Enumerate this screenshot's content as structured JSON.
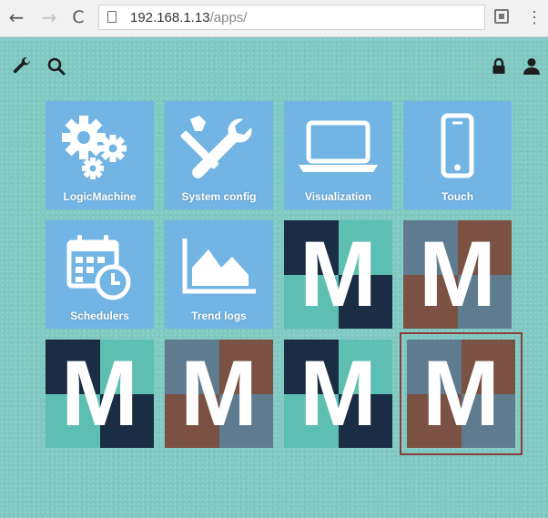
{
  "browser": {
    "url_host": "192.168.1.13",
    "url_path": "/apps/",
    "back_icon": "arrow-left-icon",
    "forward_icon": "arrow-right-icon",
    "reload_icon": "reload-icon",
    "page_icon": "document-icon",
    "extension_icon": "tack-icon",
    "cast_icon": "cast-icon",
    "menu_icon": "kebab-menu-icon"
  },
  "toolbar": {
    "left_icons": [
      "wrench-icon",
      "search-icon"
    ],
    "right_icons": [
      "lock-icon",
      "user-icon"
    ]
  },
  "colors": {
    "background": "#7fc9c2",
    "tile_blue": "#72b5e4",
    "m_navy": "#1b2c45",
    "m_teal": "#5dbfb2",
    "m_brown": "#7a5142",
    "m_slate": "#5f7b8f",
    "selection_border": "#8e3b3b"
  },
  "apps": [
    {
      "label": "LogicMachine",
      "icon": "gears-icon"
    },
    {
      "label": "System config",
      "icon": "wrench-screwdriver-icon"
    },
    {
      "label": "Visualization",
      "icon": "laptop-icon"
    },
    {
      "label": "Touch",
      "icon": "smartphone-icon"
    },
    {
      "label": "Schedulers",
      "icon": "calendar-clock-icon"
    },
    {
      "label": "Trend logs",
      "icon": "area-chart-icon"
    }
  ],
  "m_tiles": [
    {
      "letter": "M",
      "scheme": "navy-teal"
    },
    {
      "letter": "M",
      "scheme": "slate-brown"
    },
    {
      "letter": "M",
      "scheme": "navy-teal"
    },
    {
      "letter": "M",
      "scheme": "slate-brown"
    },
    {
      "letter": "M",
      "scheme": "navy-teal"
    },
    {
      "letter": "M",
      "scheme": "slate-brown",
      "selected": true
    }
  ]
}
